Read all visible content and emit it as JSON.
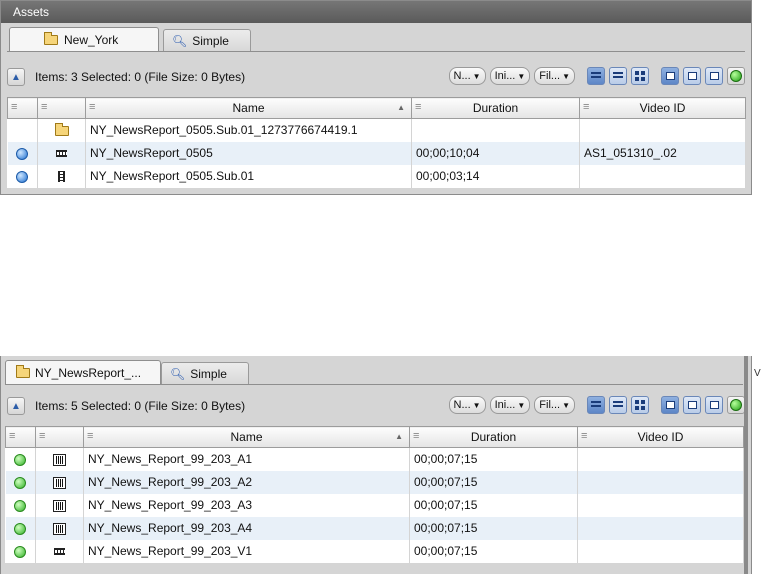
{
  "panel1": {
    "title": "Assets",
    "tabs": [
      {
        "label": "New_York",
        "icon": "folder-icon",
        "active": true
      },
      {
        "label": "Simple",
        "icon": "search-icon",
        "active": false
      }
    ],
    "status": "Items: 3 Selected: 0 (File Size: 0 Bytes)",
    "dropdowns": [
      "N...",
      "Ini...",
      "Fil..."
    ],
    "columns": [
      "",
      "",
      "Name",
      "Duration",
      "Video ID"
    ],
    "rows": [
      {
        "indicator": "",
        "icon": "folder-icon",
        "name": "NY_NewsReport_0505.Sub.01_1273776674419.1",
        "duration": "",
        "video_id": ""
      },
      {
        "indicator": "blue",
        "icon": "film-strip-icon",
        "name": "NY_NewsReport_0505",
        "duration": "00;00;10;04",
        "video_id": "AS1_051310_.02"
      },
      {
        "indicator": "blue",
        "icon": "film-strip-vertical-icon",
        "name": "NY_NewsReport_0505.Sub.01",
        "duration": "00;00;03;14",
        "video_id": ""
      }
    ]
  },
  "panel2": {
    "tabs": [
      {
        "label": "NY_NewsReport_...",
        "icon": "folder-icon",
        "active": true
      },
      {
        "label": "Simple",
        "icon": "search-icon",
        "active": false
      }
    ],
    "status": "Items: 5 Selected: 0 (File Size: 0 Bytes)",
    "dropdowns": [
      "N...",
      "Ini...",
      "Fil..."
    ],
    "columns": [
      "",
      "",
      "Name",
      "Duration",
      "Video ID"
    ],
    "rows": [
      {
        "indicator": "green",
        "icon": "audio-waveform-icon",
        "name": "NY_News_Report_99_203_A1",
        "duration": "00;00;07;15",
        "video_id": ""
      },
      {
        "indicator": "green",
        "icon": "audio-waveform-icon",
        "name": "NY_News_Report_99_203_A2",
        "duration": "00;00;07;15",
        "video_id": ""
      },
      {
        "indicator": "green",
        "icon": "audio-waveform-icon",
        "name": "NY_News_Report_99_203_A3",
        "duration": "00;00;07;15",
        "video_id": ""
      },
      {
        "indicator": "green",
        "icon": "audio-waveform-icon",
        "name": "NY_News_Report_99_203_A4",
        "duration": "00;00;07;15",
        "video_id": ""
      },
      {
        "indicator": "green",
        "icon": "film-strip-icon",
        "name": "NY_News_Report_99_203_V1",
        "duration": "00;00;07;15",
        "video_id": ""
      }
    ]
  },
  "edge_label": "V",
  "colors": {
    "row_alt": "#e8f0f8",
    "status_blue": "#1e6fd0",
    "status_green": "#2fb024",
    "title_bar": "#6a6a6a"
  }
}
